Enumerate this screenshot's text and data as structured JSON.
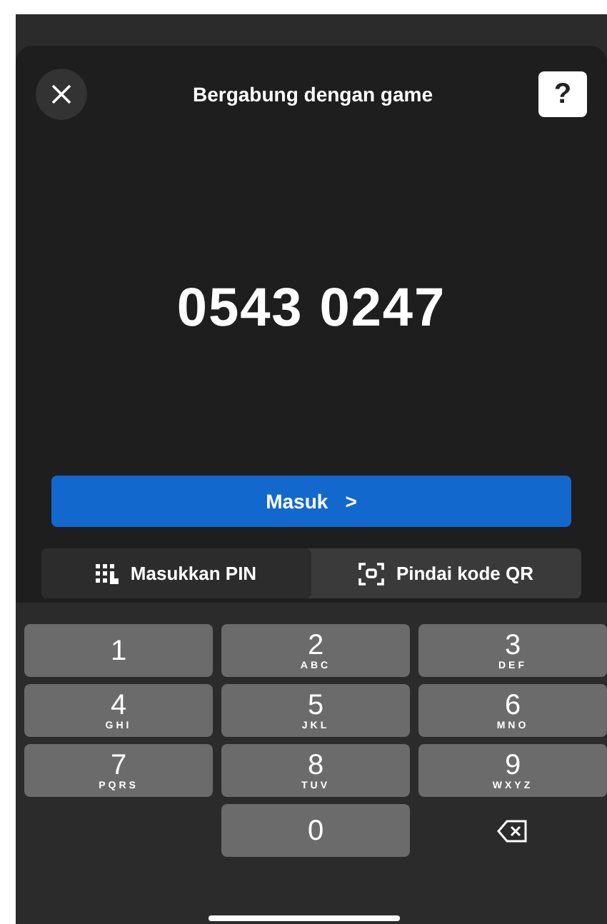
{
  "header": {
    "title": "Bergabung dengan game",
    "help": "?"
  },
  "game_pin": "0543 0247",
  "submit_button": {
    "label": "Masuk",
    "arrow": ">"
  },
  "tabs": [
    {
      "label": "Masukkan PIN",
      "kind": "keypad",
      "selected": true
    },
    {
      "label": "Pindai kode QR",
      "kind": "scan",
      "selected": false
    }
  ],
  "keypad": [
    {
      "kind": "digit",
      "digit": "1"
    },
    {
      "kind": "digit",
      "digit": "2",
      "letters": "ABC"
    },
    {
      "kind": "digit",
      "digit": "3",
      "letters": "DEF"
    },
    {
      "kind": "digit",
      "digit": "4",
      "letters": "GHI"
    },
    {
      "kind": "digit",
      "digit": "5",
      "letters": "JKL"
    },
    {
      "kind": "digit",
      "digit": "6",
      "letters": "MNO"
    },
    {
      "kind": "digit",
      "digit": "7",
      "letters": "PQRS"
    },
    {
      "kind": "digit",
      "digit": "8",
      "letters": "TUV"
    },
    {
      "kind": "digit",
      "digit": "9",
      "letters": "WXYZ"
    },
    {
      "kind": "blank"
    },
    {
      "kind": "digit",
      "digit": "0"
    },
    {
      "kind": "backspace"
    }
  ]
}
